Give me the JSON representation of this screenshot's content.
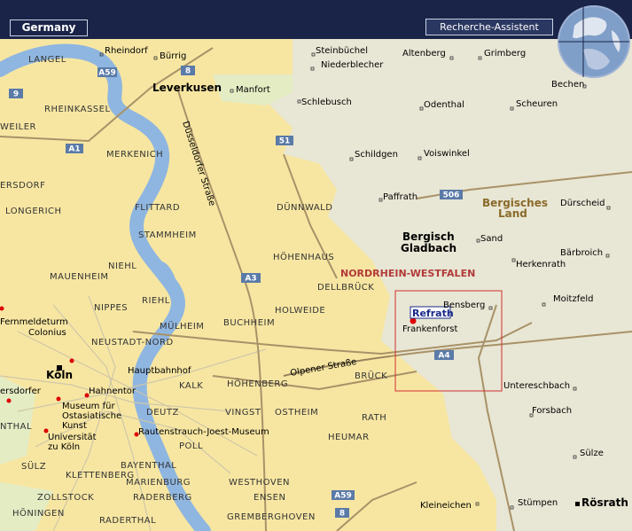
{
  "header": {
    "country": "Germany",
    "assistant_label": "Recherche-Assistent"
  },
  "colors": {
    "topbar": "#1a2448",
    "urban": "#f7e6a2",
    "rural": "#eceada",
    "green": "#e4ecc4",
    "river": "#8fb6e0",
    "road": "#a89268",
    "state_label": "#b23a3a",
    "region_label": "#8a6a2a",
    "marker": "#dd0000"
  },
  "map": {
    "highlight_place": "Refrath",
    "state": "NORDRHEIN-WESTFALEN",
    "region": [
      "Bergisches",
      "Land"
    ],
    "cities": {
      "koeln": "Köln",
      "leverkusen": "Leverkusen",
      "bergisch_gladbach": [
        "Bergisch",
        "Gladbach"
      ],
      "roesrath": "Rösrath"
    },
    "districts": {
      "langel": "LANGEL",
      "rheinkassel": "RHEINKASSEL",
      "weiler": "WEILER",
      "merkenich": "MERKENICH",
      "ersdorf": "ERSDORF",
      "longerich": "LONGERICH",
      "flittard": "FLITTARD",
      "stammheim": "STAMMHEIM",
      "duennwald": "DÜNNWALD",
      "hoehenhaus": "HÖHENHAUS",
      "dellbrueck": "DELLBRÜCK",
      "holweide": "HOLWEIDE",
      "niehl": "NIEHL",
      "mauenheim": "MAUENHEIM",
      "riehl": "RIEHL",
      "nippes": "NIPPES",
      "muelheim": "MÜLHEIM",
      "buchheim": "BUCHHEIM",
      "neustadt_nord": "NEUSTADT-NORD",
      "kalk": "KALK",
      "hoehenberg": "HÖHENBERG",
      "brueck": "BRÜCK",
      "deutz": "DEUTZ",
      "vingst": "VINGST",
      "ostheim": "OSTHEIM",
      "rath": "RATH",
      "heumar": "HEUMAR",
      "poll": "POLL",
      "suelz": "SÜLZ",
      "klettenberg": "KLETTENBERG",
      "bayenthal": "BAYENTHAL",
      "marienburg": "MARIENBURG",
      "westhoven": "WESTHOVEN",
      "zollstock": "ZOLLSTOCK",
      "raderberg": "RADERBERG",
      "ensen": "ENSEN",
      "hoeningen": "HÖNINGEN",
      "raderthal": "RADERTHAL",
      "grembergh": "GREMBERGHOVEN",
      "nthal": "NTHAL"
    },
    "places": {
      "rheindorf": "Rheindorf",
      "buerrig": "Bürrig",
      "steinbuechel": "Steinbüchel",
      "altenberg": "Altenberg",
      "grimberg": "Grimberg",
      "niederblecher": "Niederblecher",
      "bechen": "Bechen",
      "manfort": "Manfort",
      "schlebusch": "Schlebusch",
      "odenthal": "Odenthal",
      "scheuren": "Scheuren",
      "schildgen": "Schildgen",
      "voiswinkel": "Voiswinkel",
      "paffrath": "Paffrath",
      "duerscheid": "Dürscheid",
      "sand": "Sand",
      "baerbroich": "Bärbroich",
      "herkenrath": "Herkenrath",
      "moitzfeld": "Moitzfeld",
      "bensberg": "Bensberg",
      "frankenforst": "Frankenforst",
      "untereschbach": "Untereschbach",
      "forsbach": "Forsbach",
      "suelze": "Sülze",
      "kleineichen": "Kleineichen",
      "stuempen": "Stümpen"
    },
    "streets": {
      "duesseldorfer": "Düsseldorfer Straße",
      "olpener": "Olpener Straße"
    },
    "pois": {
      "fernmeldeturm": [
        "Fernmeldeturm",
        "Colonius"
      ],
      "hahnentor": "Hahnentor",
      "ersdorfer": "ersdorfer",
      "museum_asia": [
        "Museum für",
        "Ostasiatische",
        "Kunst"
      ],
      "rautenstrauch": "Rautenstrauch-Joest-Museum",
      "universitaet": [
        "Universität",
        "zu Köln"
      ],
      "hauptbahnhof": "Hauptbahnhof"
    },
    "road_shields": {
      "a59_top": "A59",
      "b8_top": "8",
      "b9": "9",
      "a1": "A1",
      "b51": "51",
      "b506": "506",
      "a3": "A3",
      "a4": "A4",
      "a59_bottom": "A59",
      "b8_bottom": "8"
    }
  }
}
